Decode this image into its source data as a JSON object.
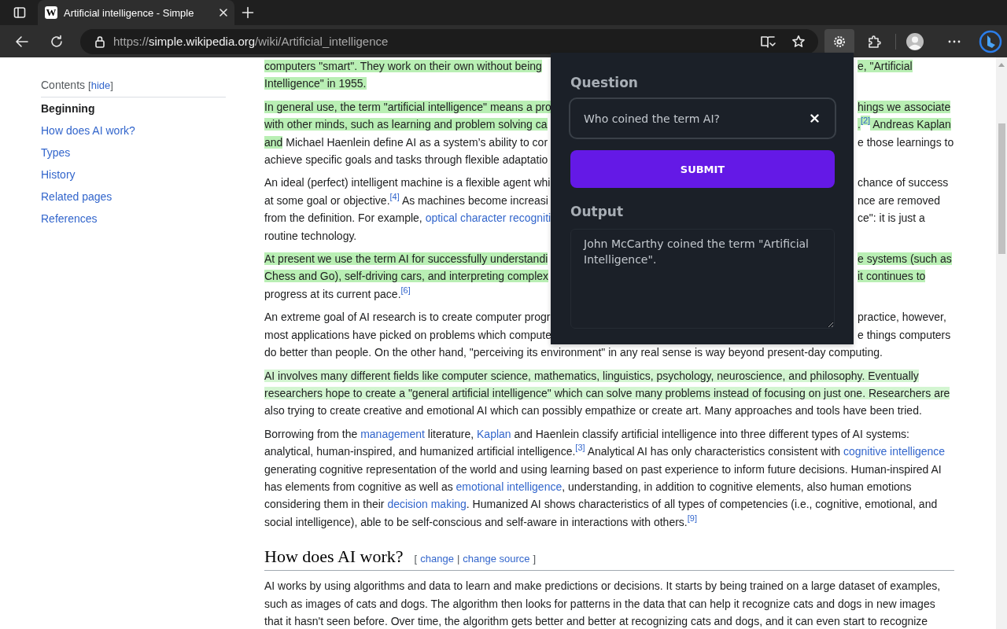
{
  "browser": {
    "tab": {
      "favicon_letter": "W",
      "title": "Artificial intelligence - Simple"
    },
    "url": {
      "scheme": "https://",
      "host": "simple.wikipedia.org",
      "path": "/wiki/Artificial_intelligence"
    },
    "extension_button": {
      "selected": true
    }
  },
  "sidebar": {
    "title": "Contents",
    "toggle": {
      "open": "[",
      "label": "hide",
      "close": "]"
    },
    "items": [
      {
        "label": "Beginning",
        "selected": true
      },
      {
        "label": "How does AI work?",
        "selected": false
      },
      {
        "label": "Types",
        "selected": false
      },
      {
        "label": "History",
        "selected": false
      },
      {
        "label": "Related pages",
        "selected": false
      },
      {
        "label": "References",
        "selected": false
      }
    ]
  },
  "article": {
    "paragraphs": [
      {
        "kind": "split",
        "lines": [
          {
            "left": [
              {
                "text": "computers \"smart\". They work on their own without being",
                "kind": "plain",
                "highlighted": true
              }
            ],
            "right": [
              {
                "text": "e, \"Artificial",
                "kind": "plain",
                "highlighted": true
              }
            ]
          },
          {
            "left": [
              {
                "text": "Intelligence\" in 1955.",
                "kind": "plain",
                "highlighted": true
              }
            ]
          }
        ]
      },
      {
        "kind": "split",
        "lines": [
          {
            "left": [
              {
                "text": "In general use, the term \"artificial intelligence\" means a pro",
                "kind": "plain",
                "highlighted": true
              }
            ],
            "right": [
              {
                "text": "hings we associate",
                "kind": "plain",
                "highlighted": true
              }
            ]
          },
          {
            "left": [
              {
                "text": "with other minds, such as learning and problem solving ca",
                "kind": "plain",
                "highlighted": true
              }
            ],
            "right": [
              {
                "text": ".",
                "kind": "plain",
                "highlighted": true
              },
              {
                "text": "[2]",
                "kind": "ref",
                "highlighted": true
              },
              {
                "text": " Andreas Kaplan",
                "kind": "plain",
                "highlighted": true
              }
            ]
          },
          {
            "left": [
              {
                "text": "and",
                "kind": "plain",
                "highlighted": true
              },
              {
                "text": " Michael Haenlein define AI as a system’s ability to cor",
                "kind": "plain",
                "highlighted": false
              }
            ],
            "right": [
              {
                "text": "e those learnings to",
                "kind": "plain",
                "highlighted": false
              }
            ]
          },
          {
            "left": [
              {
                "text": "achieve specific goals and tasks through flexible adaptatio",
                "kind": "plain",
                "highlighted": false
              }
            ]
          }
        ]
      },
      {
        "kind": "split",
        "lines": [
          {
            "left": [
              {
                "text": "An ideal (perfect) intelligent machine is a flexible agent whi",
                "kind": "plain",
                "highlighted": false
              }
            ],
            "right": [
              {
                "text": "chance of success",
                "kind": "plain",
                "highlighted": false
              }
            ]
          },
          {
            "left": [
              {
                "text": "at some goal or objective.",
                "kind": "plain",
                "highlighted": false
              },
              {
                "text": "[4]",
                "kind": "ref",
                "highlighted": false
              },
              {
                "text": " As machines become increasi",
                "kind": "plain",
                "highlighted": false
              }
            ],
            "right": [
              {
                "text": "nce are removed",
                "kind": "plain",
                "highlighted": false
              }
            ]
          },
          {
            "left": [
              {
                "text": "from the definition. For example, ",
                "kind": "plain",
                "highlighted": false
              },
              {
                "text": "optical character recogniti",
                "kind": "link",
                "highlighted": false
              }
            ],
            "right": [
              {
                "text": "ce\": it is just a",
                "kind": "plain",
                "highlighted": false
              }
            ]
          },
          {
            "left": [
              {
                "text": "routine technology.",
                "kind": "plain",
                "highlighted": false
              }
            ]
          }
        ]
      },
      {
        "kind": "split",
        "lines": [
          {
            "left": [
              {
                "text": "At present we use the term AI for successfully understandi",
                "kind": "plain",
                "highlighted": true
              }
            ],
            "right": [
              {
                "text": "e systems (such as",
                "kind": "plain",
                "highlighted": true
              }
            ]
          },
          {
            "left": [
              {
                "text": "Chess and Go), self-driving cars, and interpreting complex",
                "kind": "plain",
                "highlighted": true
              }
            ],
            "right": [
              {
                "text": "it continues to",
                "kind": "plain",
                "highlighted": true
              }
            ]
          },
          {
            "left": [
              {
                "text": "progress at its current pace.",
                "kind": "plain",
                "highlighted": false
              },
              {
                "text": "[6]",
                "kind": "ref",
                "highlighted": false
              }
            ]
          }
        ]
      },
      {
        "kind": "split",
        "lines": [
          {
            "left": [
              {
                "text": "An extreme goal of AI research is to create computer progr",
                "kind": "plain",
                "highlighted": false
              }
            ],
            "right": [
              {
                "text": "practice, however,",
                "kind": "plain",
                "highlighted": false
              }
            ]
          },
          {
            "left": [
              {
                "text": "most applications have picked on problems which compute",
                "kind": "plain",
                "highlighted": false
              }
            ],
            "right": [
              {
                "text": "e things computers",
                "kind": "plain",
                "highlighted": false
              }
            ]
          },
          {
            "left": [
              {
                "text": "do better than people. On the other hand, \"perceiving its environment\" in any real sense is way beyond present-day computing.",
                "kind": "plain",
                "highlighted": false
              }
            ]
          }
        ]
      },
      {
        "kind": "flow",
        "segments": [
          {
            "text": "AI involves many different fields like computer science, mathematics, linguistics, psychology, neuroscience, and philosophy. Eventually researchers hope to create a \"general artificial intelligence\" which can solve many problems instead of focusing on just one. Researchers are",
            "kind": "plain",
            "highlighted": true
          },
          {
            "text": " also trying to create creative and emotional AI which can possibly empathize or create art. Many approaches and tools have been tried.",
            "kind": "plain",
            "highlighted": false
          }
        ]
      },
      {
        "kind": "flow",
        "segments": [
          {
            "text": "Borrowing from the ",
            "kind": "plain",
            "highlighted": false
          },
          {
            "text": "management",
            "kind": "link",
            "highlighted": false
          },
          {
            "text": " literature, ",
            "kind": "plain",
            "highlighted": false
          },
          {
            "text": "Kaplan",
            "kind": "link",
            "highlighted": false
          },
          {
            "text": " and Haenlein classify artificial intelligence into three different types of AI systems: analytical, human-inspired, and humanized artificial intelligence.",
            "kind": "plain",
            "highlighted": false
          },
          {
            "text": "[3]",
            "kind": "ref",
            "highlighted": false
          },
          {
            "text": " Analytical AI has only characteristics consistent with ",
            "kind": "plain",
            "highlighted": false
          },
          {
            "text": "cognitive intelligence",
            "kind": "link",
            "highlighted": false
          },
          {
            "text": " generating cognitive representation of the world and using learning based on past experience to inform future decisions. Human-inspired AI has elements from cognitive as well as ",
            "kind": "plain",
            "highlighted": false
          },
          {
            "text": "emotional intelligence",
            "kind": "link",
            "highlighted": false
          },
          {
            "text": ", understanding, in addition to cognitive elements, also human emotions considering them in their ",
            "kind": "plain",
            "highlighted": false
          },
          {
            "text": "decision making",
            "kind": "link",
            "highlighted": false
          },
          {
            "text": ". Humanized AI shows characteristics of all types of competencies (i.e., cognitive, emotional, and social intelligence), able to be self-conscious and self-aware in interactions with others.",
            "kind": "plain",
            "highlighted": false
          },
          {
            "text": "[9]",
            "kind": "ref",
            "highlighted": false
          }
        ]
      },
      {
        "kind": "heading",
        "text": "How does AI work?",
        "edit": {
          "open": "[",
          "links": [
            "change",
            "change source"
          ],
          "separator": "|",
          "close": "]"
        }
      },
      {
        "kind": "flow",
        "segments": [
          {
            "text": "AI works by using algorithms and data to learn and make predictions or decisions. It starts by being trained on a large dataset of examples, such as images of cats and dogs. The algorithm then looks for patterns in the data that can help it recognize cats and dogs in new images that it hasn't seen before. Over time, the algorithm gets better and better at recognizing cats and dogs, and it can even start to recognize",
            "kind": "plain",
            "highlighted": false
          }
        ]
      }
    ]
  },
  "popup": {
    "question_label": "Question",
    "question_value": "Who coined the term AI?",
    "submit": "SUBMIT",
    "output_label": "Output",
    "output_value": "John McCarthy coined the term \"Artificial Intelligence\"."
  }
}
